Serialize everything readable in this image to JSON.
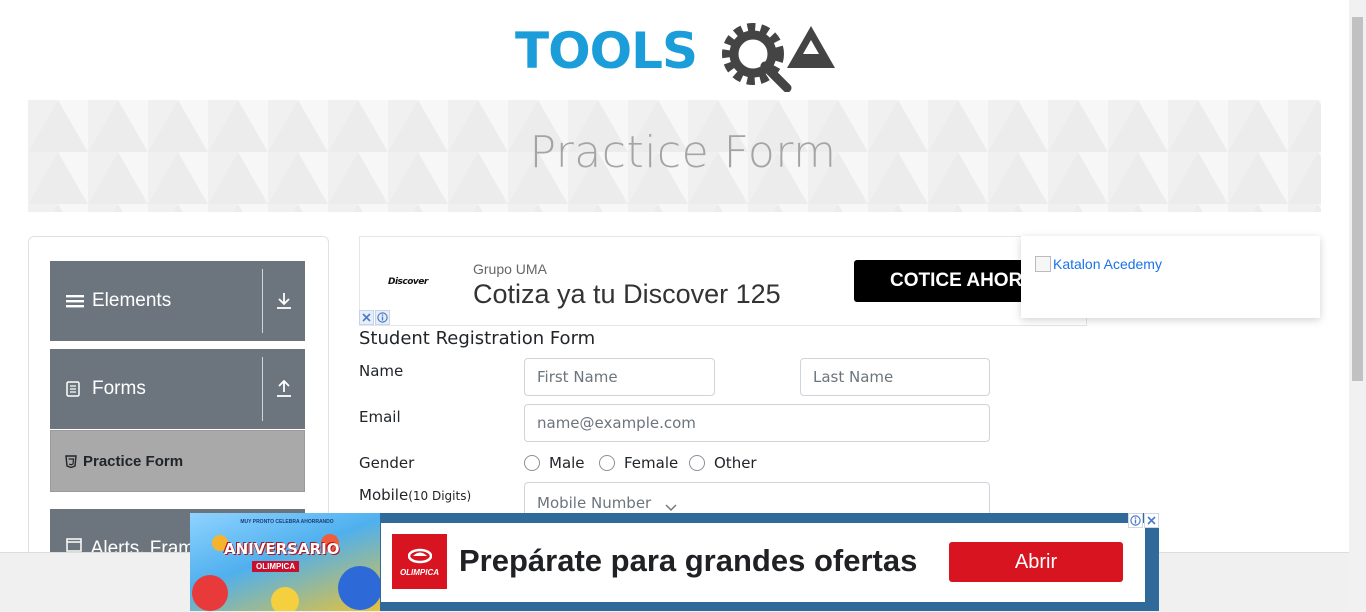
{
  "logo": {
    "text_part": "TOOLS",
    "qa_part": "QA"
  },
  "banner": {
    "title": "Practice Form"
  },
  "sidebar": {
    "groups": [
      {
        "label": "Elements",
        "icon": "hamburger-icon",
        "toggle": "download-arrow-icon"
      },
      {
        "label": "Forms",
        "icon": "document-icon",
        "toggle": "upload-arrow-icon"
      },
      {
        "label": "Alerts, Frame & Windows",
        "icon": "window-icon"
      }
    ],
    "active_item": {
      "label": "Practice Form",
      "icon": "html5-icon"
    }
  },
  "ad_top": {
    "brand": "Discover",
    "company": "Grupo UMA",
    "headline": "Cotiza ya tu Discover 125",
    "cta": "COTICE AHORA"
  },
  "katalon": {
    "link_text": "Katalon Acedemy"
  },
  "form": {
    "title": "Student Registration Form",
    "name_label": "Name",
    "first_name_placeholder": "First Name",
    "last_name_placeholder": "Last Name",
    "email_label": "Email",
    "email_placeholder": "name@example.com",
    "gender_label": "Gender",
    "gender_options": [
      "Male",
      "Female",
      "Other"
    ],
    "mobile_label": "Mobile",
    "mobile_hint": "(10 Digits)",
    "mobile_placeholder": "Mobile Number"
  },
  "ad_bottom": {
    "promo_small": "MUY PRONTO CELEBRA AHORRANDO",
    "promo_title": "ANIVERSARIO",
    "promo_brand": "OLIMPICA",
    "logo_text": "OLIMPICA",
    "headline": "Prepárate para grandes ofertas",
    "cta": "Abrir"
  },
  "colors": {
    "accent_blue": "#1a9dd9",
    "logo_dark": "#444444",
    "sidebar_group": "#6c757d",
    "active_item": "#a9a9a9",
    "cta_red": "#d7141f"
  }
}
